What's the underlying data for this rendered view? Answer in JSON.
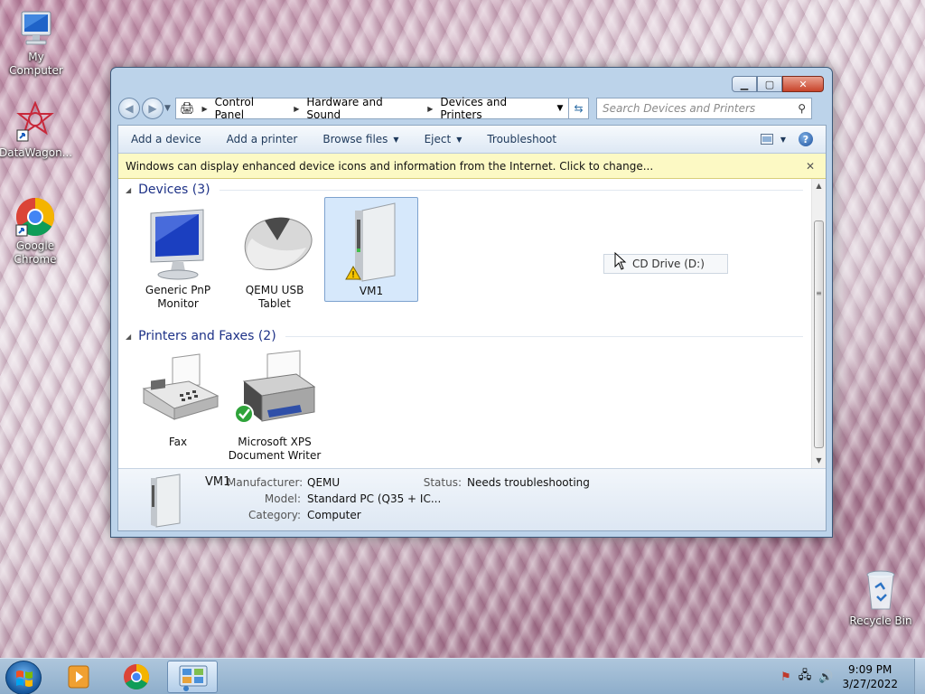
{
  "desktop": {
    "icons": [
      {
        "label": "My Computer"
      },
      {
        "label": "DataWagon..."
      },
      {
        "label": "Google Chrome"
      },
      {
        "label": "Recycle Bin"
      }
    ]
  },
  "window": {
    "breadcrumb": [
      "Control Panel",
      "Hardware and Sound",
      "Devices and Printers"
    ],
    "search_placeholder": "Search Devices and Printers",
    "toolbar": {
      "add_device": "Add a device",
      "add_printer": "Add a printer",
      "browse_files": "Browse files",
      "eject": "Eject",
      "troubleshoot": "Troubleshoot"
    },
    "infobar": "Windows can display enhanced device icons and information from the Internet. Click to change...",
    "groups": {
      "devices": {
        "title": "Devices (3)"
      },
      "printers": {
        "title": "Printers and Faxes (2)"
      }
    },
    "devices": [
      {
        "name": "Generic PnP Monitor"
      },
      {
        "name": "QEMU USB Tablet"
      },
      {
        "name": "VM1",
        "selected": true,
        "warning": true
      }
    ],
    "printers": [
      {
        "name": "Fax"
      },
      {
        "name": "Microsoft XPS Document Writer",
        "default": true
      }
    ],
    "drag_tooltip": "CD Drive (D:)",
    "details": {
      "name": "VM1",
      "manufacturer_label": "Manufacturer:",
      "manufacturer": "QEMU",
      "model_label": "Model:",
      "model": "Standard PC (Q35 + IC...",
      "category_label": "Category:",
      "category": "Computer",
      "status_label": "Status:",
      "status": "Needs troubleshooting"
    }
  },
  "taskbar": {
    "time": "9:09 PM",
    "date": "3/27/2022"
  },
  "colors": {
    "group_title": "#1e3287",
    "infobar_bg": "#fcf9c4",
    "selection_bg": "#d6e8fb",
    "taskbar": "#9fbbd5"
  }
}
